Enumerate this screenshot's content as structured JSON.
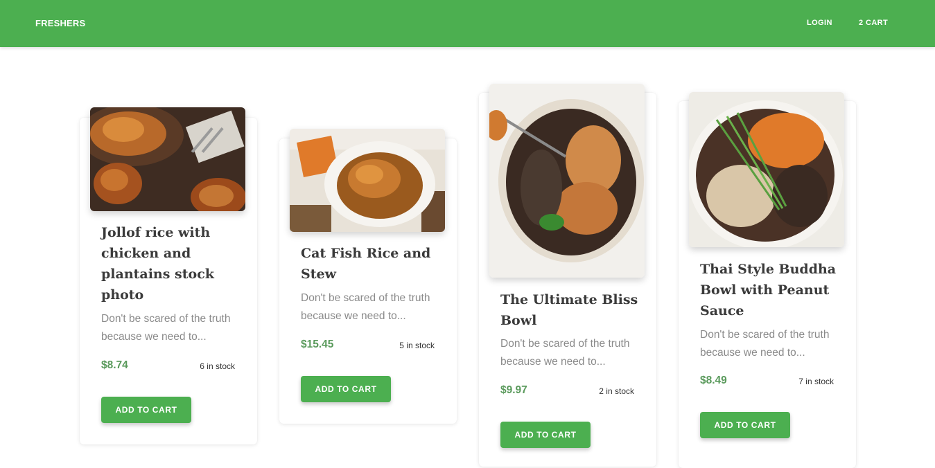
{
  "navbar": {
    "brand": "FRESHERS",
    "login_label": "LOGIN",
    "cart_label": "2 CART"
  },
  "products": [
    {
      "title": "Jollof rice with chicken and plantains stock photo",
      "description": "Don't be scared of the truth because we need to...",
      "price": "$8.74",
      "stock": "6 in stock",
      "button_label": "ADD TO CART"
    },
    {
      "title": "Cat Fish Rice and Stew",
      "description": "Don't be scared of the truth because we need to...",
      "price": "$15.45",
      "stock": "5 in stock",
      "button_label": "ADD TO CART"
    },
    {
      "title": "The Ultimate Bliss Bowl",
      "description": "Don't be scared of the truth because we need to...",
      "price": "$9.97",
      "stock": "2 in stock",
      "button_label": "ADD TO CART"
    },
    {
      "title": "Thai Style Buddha Bowl with Peanut Sauce",
      "description": "Don't be scared of the truth because we need to...",
      "price": "$8.49",
      "stock": "7 in stock",
      "button_label": "ADD TO CART"
    }
  ],
  "colors": {
    "primary": "#4caf50",
    "price": "#5a9a5c",
    "title": "#3a3a3a",
    "description": "#8a8a8a"
  }
}
